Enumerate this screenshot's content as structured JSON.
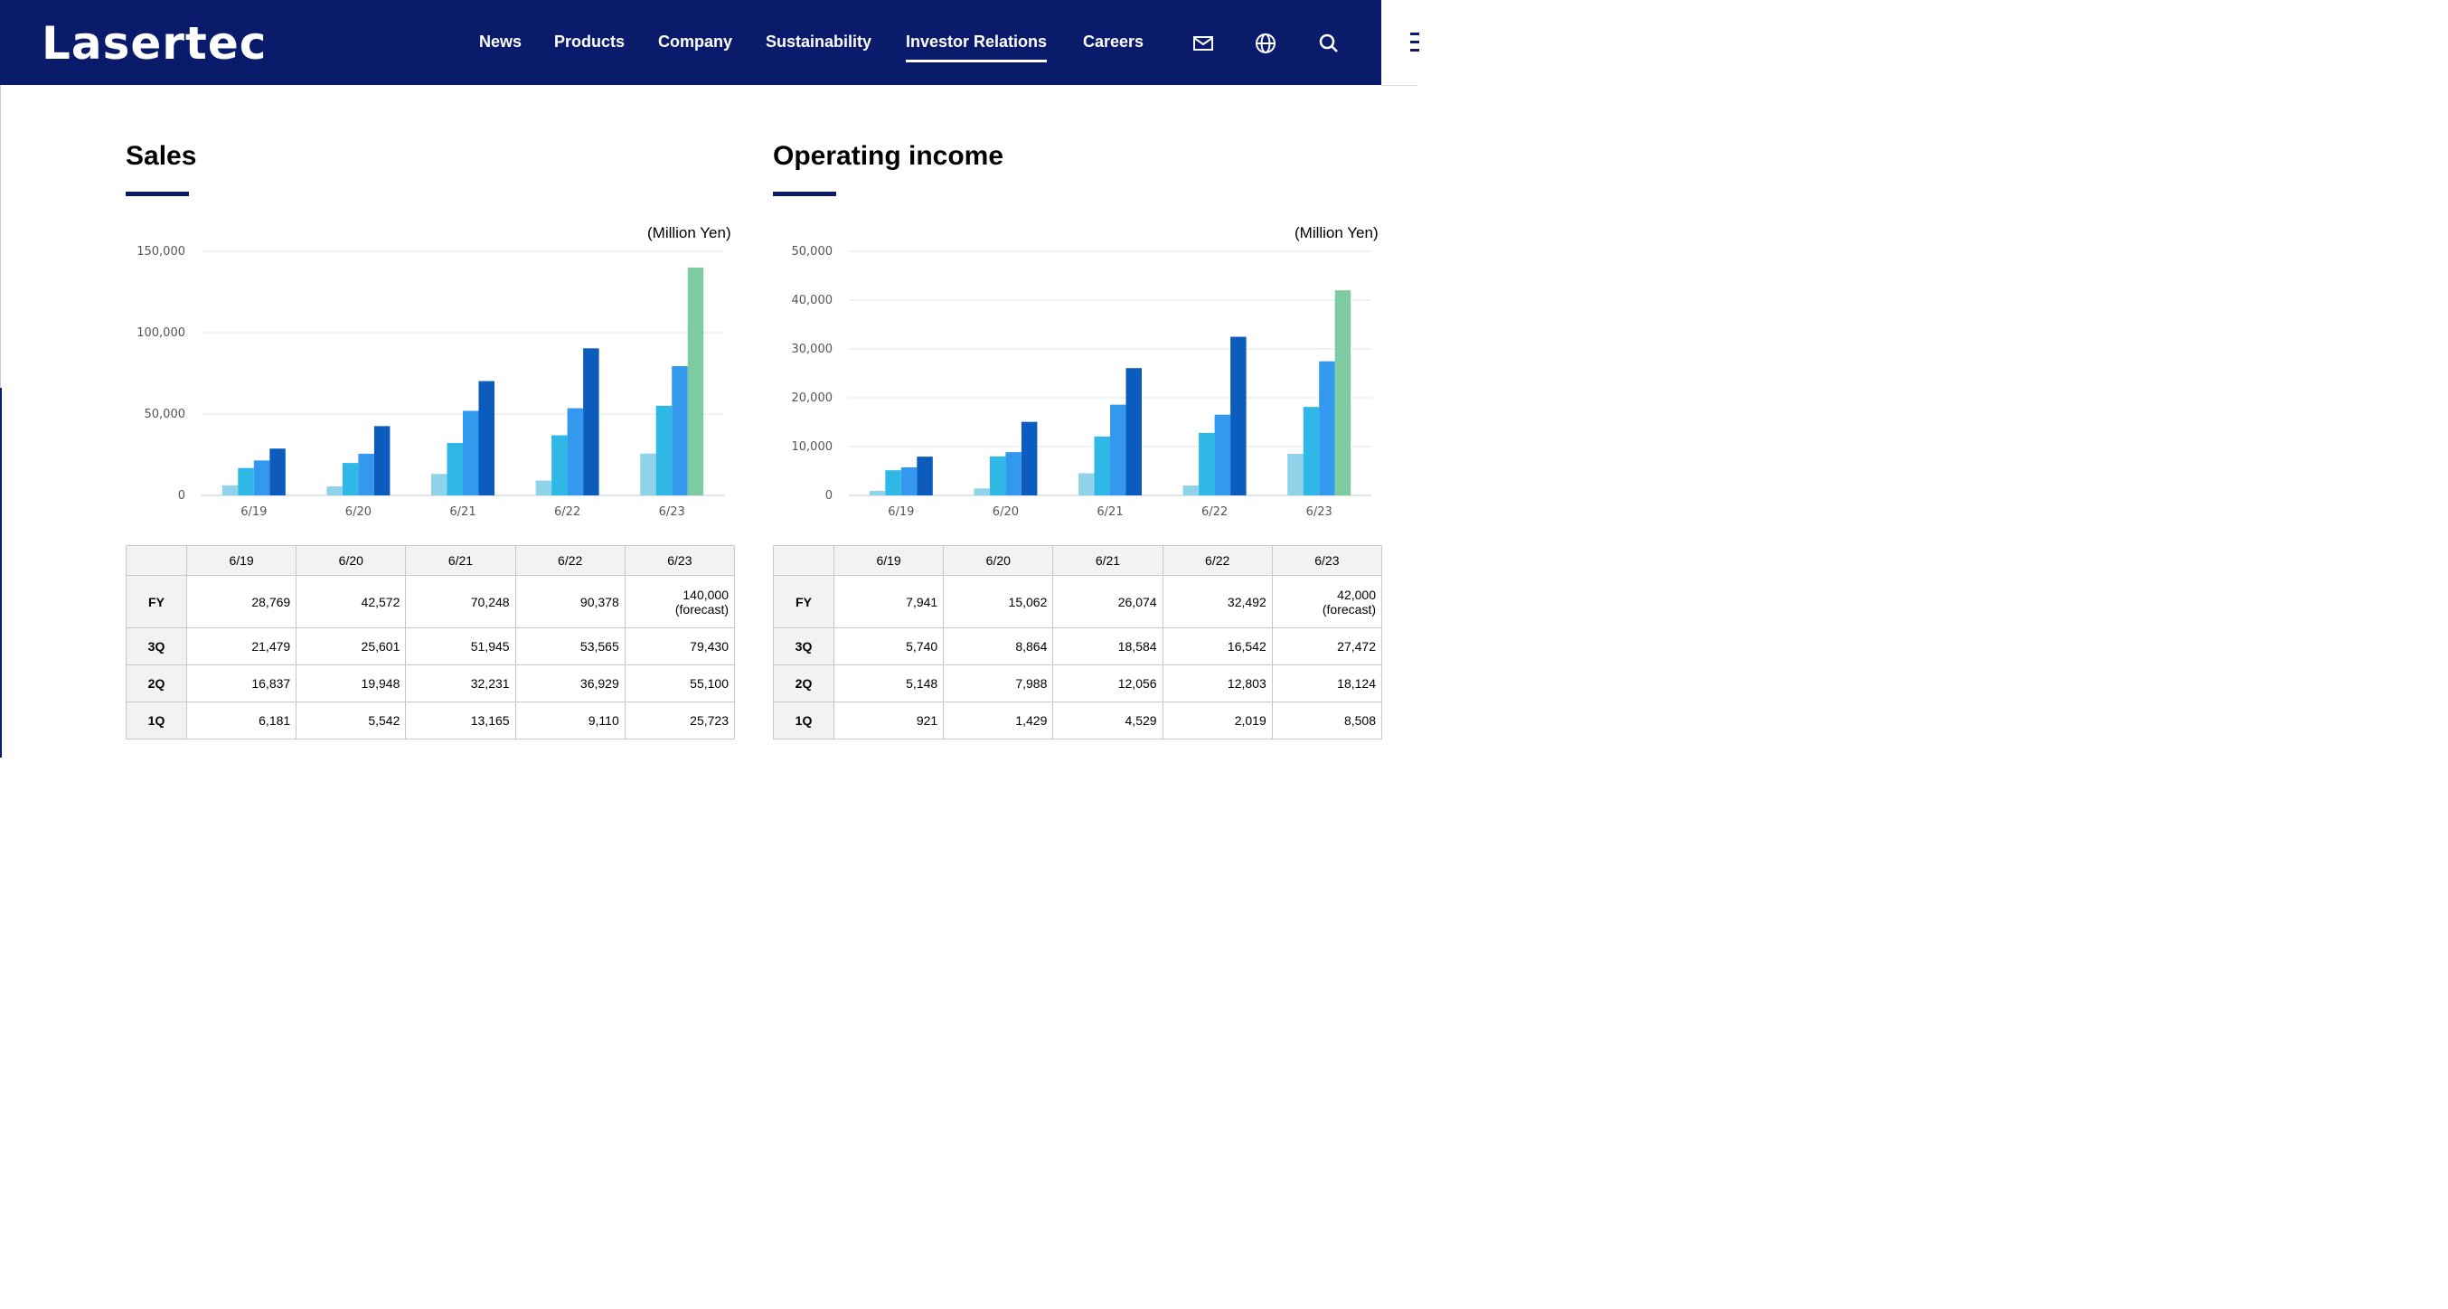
{
  "header": {
    "logo": "Lasertec",
    "nav": [
      "News",
      "Products",
      "Company",
      "Sustainability",
      "Investor Relations",
      "Careers"
    ],
    "active_nav": "Investor Relations",
    "icons": [
      "mail-icon",
      "globe-icon",
      "search-icon",
      "menu-icon"
    ]
  },
  "colors": {
    "header_bg": "#0a1b6b",
    "q1": "#8fd3ea",
    "q2": "#2fb8e6",
    "q3": "#3399ee",
    "fy": "#0b5cbd",
    "forecast": "#7ecba1"
  },
  "sales": {
    "title": "Sales",
    "unit": "(Million Yen)",
    "table": {
      "columns": [
        "6/19",
        "6/20",
        "6/21",
        "6/22",
        "6/23"
      ],
      "rows": [
        {
          "label": "FY",
          "values": [
            "28,769",
            "42,572",
            "70,248",
            "90,378",
            "140,000"
          ],
          "note": "(forecast)"
        },
        {
          "label": "3Q",
          "values": [
            "21,479",
            "25,601",
            "51,945",
            "53,565",
            "79,430"
          ]
        },
        {
          "label": "2Q",
          "values": [
            "16,837",
            "19,948",
            "32,231",
            "36,929",
            "55,100"
          ]
        },
        {
          "label": "1Q",
          "values": [
            "6,181",
            "5,542",
            "13,165",
            "9,110",
            "25,723"
          ]
        }
      ]
    }
  },
  "operating_income": {
    "title": "Operating income",
    "unit": "(Million Yen)",
    "table": {
      "columns": [
        "6/19",
        "6/20",
        "6/21",
        "6/22",
        "6/23"
      ],
      "rows": [
        {
          "label": "FY",
          "values": [
            "7,941",
            "15,062",
            "26,074",
            "32,492",
            "42,000"
          ],
          "note": "(forecast)"
        },
        {
          "label": "3Q",
          "values": [
            "5,740",
            "8,864",
            "18,584",
            "16,542",
            "27,472"
          ]
        },
        {
          "label": "2Q",
          "values": [
            "5,148",
            "7,988",
            "12,056",
            "12,803",
            "18,124"
          ]
        },
        {
          "label": "1Q",
          "values": [
            "921",
            "1,429",
            "4,529",
            "2,019",
            "8,508"
          ]
        }
      ]
    }
  },
  "chart_data": [
    {
      "type": "bar",
      "categories": [
        "6/19",
        "6/20",
        "6/21",
        "6/22",
        "6/23"
      ],
      "ylim": [
        0,
        150000
      ],
      "yticks": [
        "0",
        "50,000",
        "100,000",
        "150,000"
      ],
      "yticks_values": [
        0,
        50000,
        100000,
        150000
      ],
      "grid": true,
      "series": [
        {
          "name": "1Q",
          "values": [
            6181,
            5542,
            13165,
            9110,
            25723
          ]
        },
        {
          "name": "2Q",
          "values": [
            16837,
            19948,
            32231,
            36929,
            55100
          ]
        },
        {
          "name": "3Q",
          "values": [
            21479,
            25601,
            51945,
            53565,
            79430
          ]
        },
        {
          "name": "FY",
          "values": [
            28769,
            42572,
            70248,
            90378,
            140000
          ]
        }
      ]
    },
    {
      "type": "bar",
      "categories": [
        "6/19",
        "6/20",
        "6/21",
        "6/22",
        "6/23"
      ],
      "ylim": [
        0,
        50000
      ],
      "yticks": [
        "0",
        "10,000",
        "20,000",
        "30,000",
        "40,000",
        "50,000"
      ],
      "yticks_values": [
        0,
        10000,
        20000,
        30000,
        40000,
        50000
      ],
      "grid": true,
      "series": [
        {
          "name": "1Q",
          "values": [
            921,
            1429,
            4529,
            2019,
            8508
          ]
        },
        {
          "name": "2Q",
          "values": [
            5148,
            7988,
            12056,
            12803,
            18124
          ]
        },
        {
          "name": "3Q",
          "values": [
            5740,
            8864,
            18584,
            16542,
            27472
          ]
        },
        {
          "name": "FY",
          "values": [
            7941,
            15062,
            26074,
            32492,
            42000
          ]
        }
      ]
    }
  ]
}
